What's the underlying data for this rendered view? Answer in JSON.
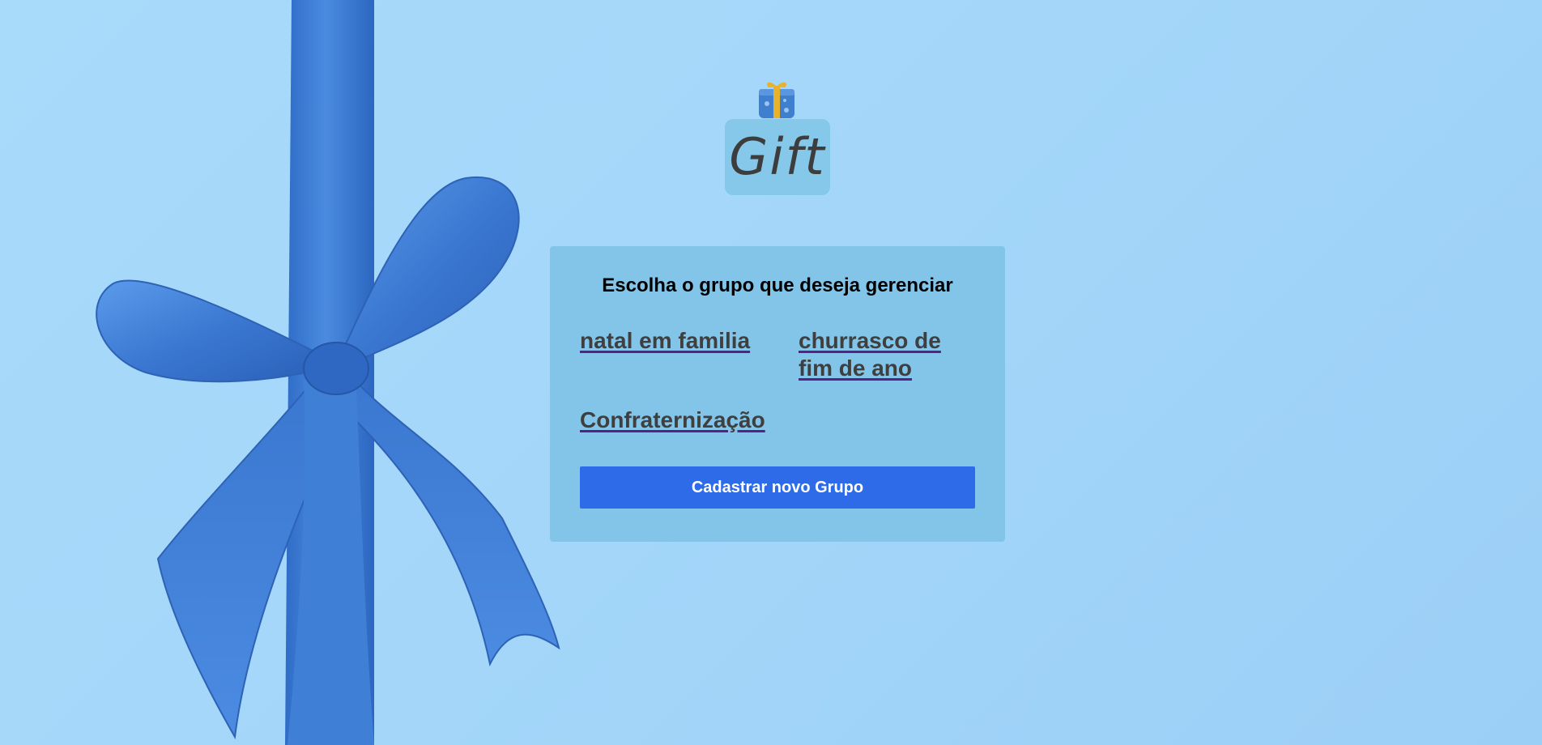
{
  "logo": {
    "text": "Gift"
  },
  "card": {
    "title": "Escolha o grupo que deseja gerenciar",
    "groups": [
      {
        "label": "natal em familia"
      },
      {
        "label": "churrasco de fim de ano"
      },
      {
        "label": "Confraternização"
      }
    ],
    "new_group_button_label": "Cadastrar novo Grupo"
  },
  "colors": {
    "background": "#a3d6f9",
    "card": "#82c5e9",
    "button": "#2e6be8",
    "link_text": "#3f3f3f",
    "link_underline": "#5d1e88",
    "ribbon": "#3f7fd6"
  }
}
